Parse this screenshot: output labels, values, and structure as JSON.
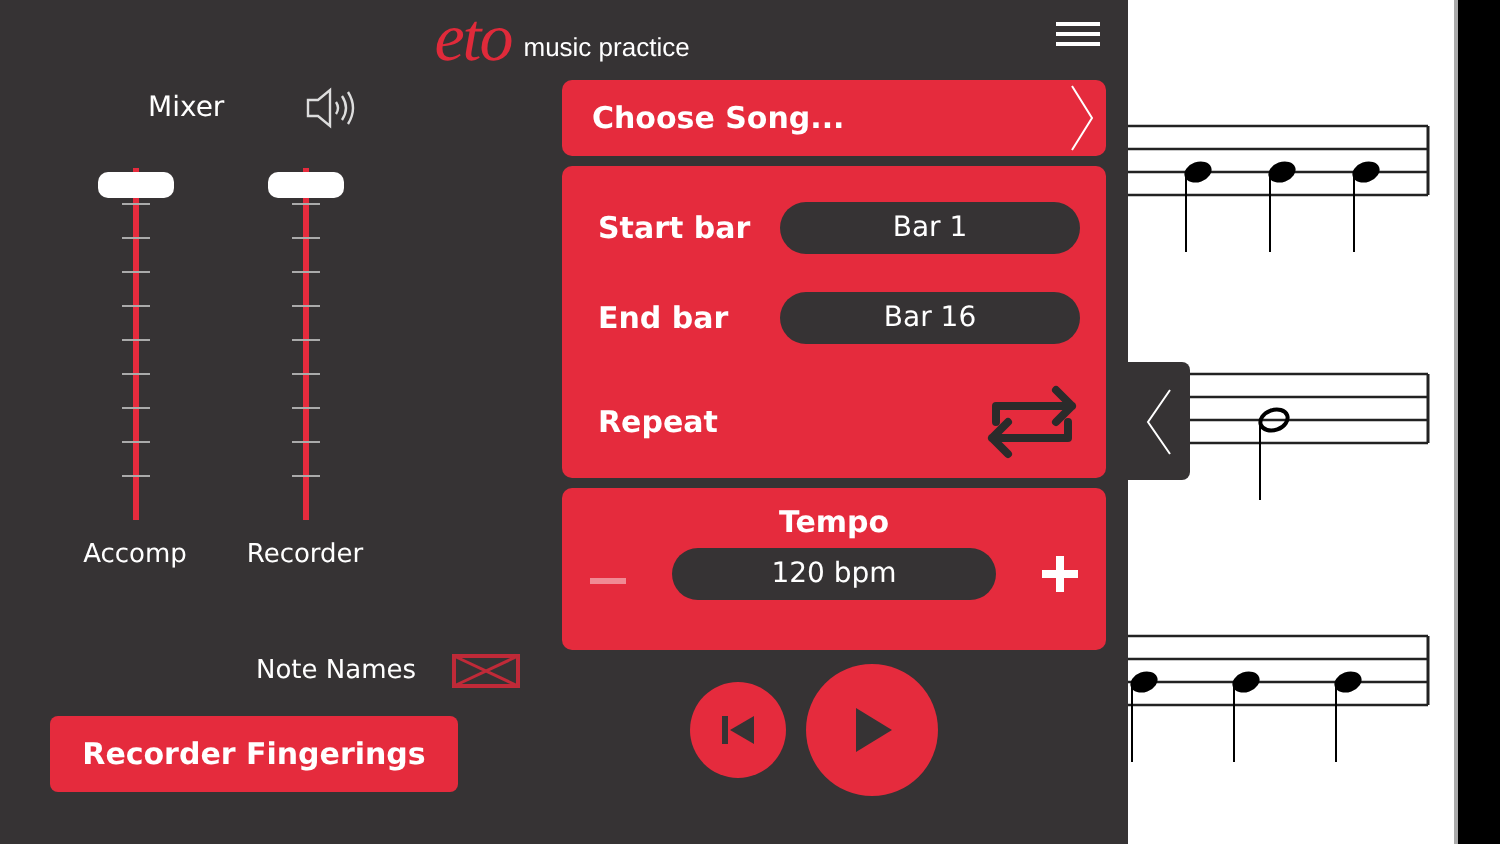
{
  "header": {
    "logo": "eto",
    "tagline": "music practice"
  },
  "mixer": {
    "title": "Mixer",
    "channels": [
      {
        "name": "Accomp",
        "level": 1
      },
      {
        "name": "Recorder",
        "level": 1
      }
    ]
  },
  "note_names": {
    "label": "Note Names",
    "checked": false
  },
  "fingerings_button": "Recorder Fingerings",
  "song": {
    "label": "Choose Song..."
  },
  "range": [
    {
      "label": "Start bar",
      "value": "Bar 1"
    },
    {
      "label": "End bar",
      "value": "Bar 16"
    }
  ],
  "repeat": {
    "label": "Repeat"
  },
  "tempo": {
    "title": "Tempo",
    "value": "120 bpm",
    "minus_disabled": true
  }
}
